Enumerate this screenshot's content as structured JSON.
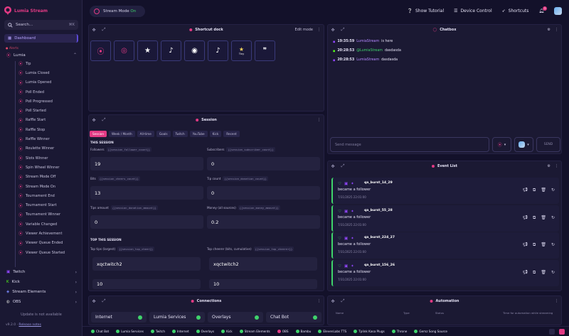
{
  "app": {
    "name": "Lumia Stream",
    "version": "v9.2.0",
    "release_notes": "Release notes",
    "update_status": "Update is not available"
  },
  "search": {
    "placeholder": "Search...",
    "shortcut": "⌘K"
  },
  "sidebar": {
    "dashboard": "Dashboard",
    "section_label": "Alerts",
    "lumia": {
      "label": "Lumia",
      "items": [
        "Tip",
        "Lumia Closed",
        "Lumia Opened",
        "Poll Ended",
        "Poll Progressed",
        "Poll Started",
        "Raffle Start",
        "Raffle Stop",
        "Raffle Winner",
        "Roulette Winner",
        "Slots Winner",
        "Spin Wheel Winner",
        "Stream Mode Off",
        "Stream Mode On",
        "Tournament End",
        "Tournament Start",
        "Tournament Winner",
        "Variable Changed",
        "Viewer Achievement",
        "Viewer Queue Ended",
        "Viewer Queue Started"
      ]
    },
    "groups": [
      {
        "label": "Twitch",
        "color": "#9146ff"
      },
      {
        "label": "Kick",
        "color": "#53fc18"
      },
      {
        "label": "Stream Elements",
        "color": "#5c6cff"
      },
      {
        "label": "OBS",
        "color": "#cfcfcf"
      }
    ]
  },
  "topbar": {
    "stream_mode_label": "Stream Mode",
    "stream_mode_state": "On",
    "show_tutorial": "Show Tutorial",
    "device_control": "Device Control",
    "shortcuts": "Shortcuts",
    "notifications_count": "3"
  },
  "shortcut_dock": {
    "title": "Shortcut dock",
    "edit_mode": "Edit mode",
    "buttons": [
      {
        "icon": "lumia-logo-icon",
        "glyph": "⦿",
        "label": ""
      },
      {
        "icon": "lumia-outline-icon",
        "glyph": "◎",
        "label": ""
      },
      {
        "icon": "star-icon",
        "glyph": "★",
        "label": ""
      },
      {
        "icon": "music-icon",
        "glyph": "♪",
        "label": ""
      },
      {
        "icon": "owl-icon",
        "glyph": "◉",
        "label": ""
      },
      {
        "icon": "tiktok-icon",
        "glyph": "♪",
        "label": ""
      },
      {
        "icon": "star-tiny-icon",
        "glyph": "★",
        "label": "Tiny"
      },
      {
        "icon": "quote-icon",
        "glyph": "❞",
        "label": ""
      }
    ]
  },
  "session": {
    "title": "Session",
    "tabs": [
      "Session",
      "Week / Month",
      "All-time",
      "Goals",
      "Twitch",
      "YouTube",
      "Kick",
      "Recent"
    ],
    "this_session": "THIS SESSION",
    "top_this_session": "TOP THIS SESSION",
    "fields": [
      {
        "label": "Followers",
        "var": "{{session_follower_count}}",
        "value": "19"
      },
      {
        "label": "Subscribers",
        "var": "{{session_subscriber_count}}",
        "value": "0"
      },
      {
        "label": "Bits",
        "var": "{{session_cheers_count}}",
        "value": "13"
      },
      {
        "label": "Tip count",
        "var": "{{session_donation_count}}",
        "value": "0"
      },
      {
        "label": "Tips amount",
        "var": "{{session_donation_amount}}",
        "value": "0"
      },
      {
        "label": "Money (all sources)",
        "var": "{{session_money_amount}}",
        "value": "0.2"
      }
    ],
    "top_fields": [
      {
        "label": "Top tips (largest)",
        "var": "{{session_top_cheer}}",
        "value": "xqctwitch2",
        "value2": "10"
      },
      {
        "label": "Top cheerer (bits, cumulative)",
        "var": "{{session_top_cheerer}}",
        "value": "xqctwitch2",
        "value2": "10"
      }
    ]
  },
  "chatbox": {
    "title": "Chatbox",
    "messages": [
      {
        "time": "19:35:59",
        "user": "LumiaStream",
        "user_color": "#b388ff",
        "text": "is here"
      },
      {
        "time": "20:28:53",
        "user": "@LumiaStream",
        "user_color": "#3fd36b",
        "text": "dasdasda"
      },
      {
        "time": "20:28:53",
        "user": "LumiaStream",
        "user_color": "#b388ff",
        "text": "dasdasda"
      }
    ],
    "send_placeholder": "Send message",
    "send_button": "SEND"
  },
  "event_list": {
    "title": "Event List",
    "events": [
      {
        "user": "qa_burst_14_29",
        "message": "became a follower",
        "time": "7/31/2025 22:01:00"
      },
      {
        "user": "qa_burst_55_28",
        "message": "became a follower",
        "time": "7/31/2025 22:01:00"
      },
      {
        "user": "qa_burst_224_27",
        "message": "became a follower",
        "time": "7/31/2025 22:01:00"
      },
      {
        "user": "qa_burst_156_26",
        "message": "became a follower",
        "time": "7/31/2025 22:01:00"
      }
    ]
  },
  "connections": {
    "title": "Connections",
    "items": [
      "Internet",
      "Lumia Services",
      "Overlays",
      "Chat Bot"
    ]
  },
  "automation": {
    "title": "Automation",
    "columns": [
      "Name",
      "Type",
      "Status",
      "Time for automation while streaming"
    ]
  },
  "statusbar": {
    "items": [
      {
        "label": "Chat Bot",
        "ok": true
      },
      {
        "label": "Lumia Services",
        "ok": true
      },
      {
        "label": "Twitch",
        "ok": true
      },
      {
        "label": "Internet",
        "ok": true
      },
      {
        "label": "Overlays",
        "ok": true
      },
      {
        "label": "Kick",
        "ok": true
      },
      {
        "label": "Stream Elements",
        "ok": true
      },
      {
        "label": "OBS",
        "ok": false
      },
      {
        "label": "Bambu",
        "ok": true
      },
      {
        "label": "ElevenLabs TTS",
        "ok": true
      },
      {
        "label": "Tplink Kasa Plugs",
        "ok": true
      },
      {
        "label": "Throne",
        "ok": true
      },
      {
        "label": "Gemz Song Source",
        "ok": true
      }
    ]
  },
  "colors": {
    "accent": "#e23a84",
    "success": "#3fd36b",
    "primary": "#5c4ad6"
  }
}
